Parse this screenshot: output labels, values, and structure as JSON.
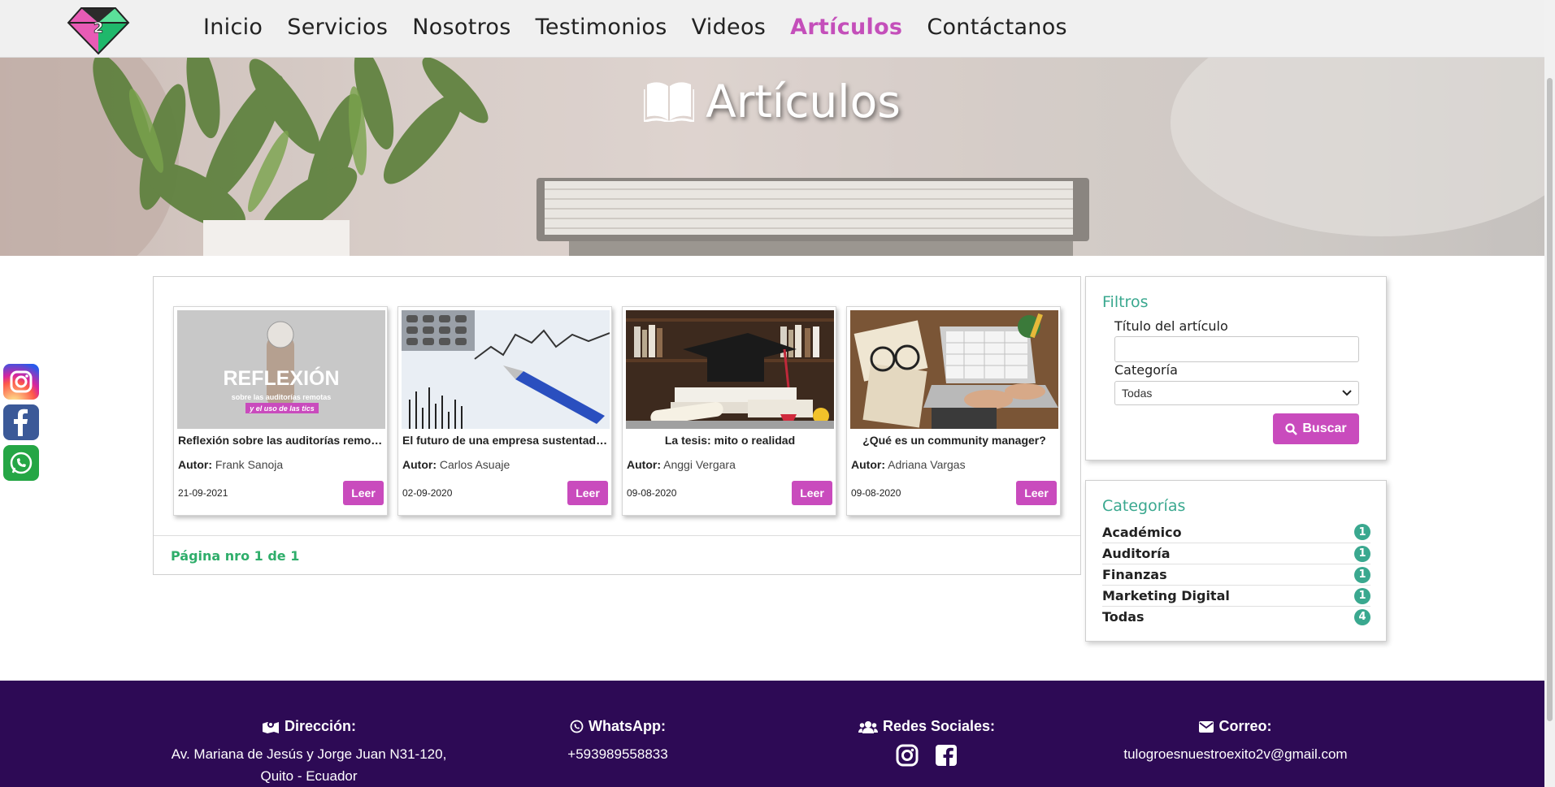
{
  "nav": {
    "links": [
      "Inicio",
      "Servicios",
      "Nosotros",
      "Testimonios",
      "Videos",
      "Artículos",
      "Contáctanos"
    ],
    "active": "Artículos",
    "logo_text": "2"
  },
  "hero": {
    "title": "Artículos",
    "icon": "book-open-icon"
  },
  "articles": [
    {
      "title": "Reflexión sobre las auditorías remotas y el uso de las tics",
      "author_label": "Autor:",
      "author": "Frank Sanoja",
      "date": "21-09-2021",
      "button": "Leer",
      "image_text": "REFLEXIÓN",
      "image_sub": "sobre las auditorías remotas",
      "image_sub2": "y el uso de las tics"
    },
    {
      "title": "El futuro de una empresa sustentada en la información",
      "author_label": "Autor:",
      "author": "Carlos Asuaje",
      "date": "02-09-2020",
      "button": "Leer"
    },
    {
      "title": "La tesis: mito o realidad",
      "author_label": "Autor:",
      "author": "Anggi Vergara",
      "date": "09-08-2020",
      "button": "Leer"
    },
    {
      "title": "¿Qué es un community manager?",
      "author_label": "Autor:",
      "author": "Adriana Vargas",
      "date": "09-08-2020",
      "button": "Leer"
    }
  ],
  "pager": "Página nro 1 de 1",
  "filters": {
    "heading": "Filtros",
    "title_label": "Título del artículo",
    "title_value": "",
    "category_label": "Categoría",
    "category_value": "Todas",
    "search_button": "Buscar"
  },
  "categories": {
    "heading": "Categorías",
    "items": [
      {
        "name": "Académico",
        "count": "1"
      },
      {
        "name": "Auditoría",
        "count": "1"
      },
      {
        "name": "Finanzas",
        "count": "1"
      },
      {
        "name": "Marketing Digital",
        "count": "1"
      },
      {
        "name": "Todas",
        "count": "4"
      }
    ]
  },
  "footer": {
    "address_label": "Dirección:",
    "address": "Av. Mariana de Jesús y Jorge Juan N31-120, Quito - Ecuador",
    "whatsapp_label": "WhatsApp:",
    "whatsapp": "+593989558833",
    "social_label": "Redes Sociales:",
    "email_label": "Correo:",
    "email": "tulogroesnuestroexito2v@gmail.com"
  },
  "colors": {
    "accent": "#c94bbd",
    "green": "#3aa88f",
    "footer": "#2d0a55"
  }
}
